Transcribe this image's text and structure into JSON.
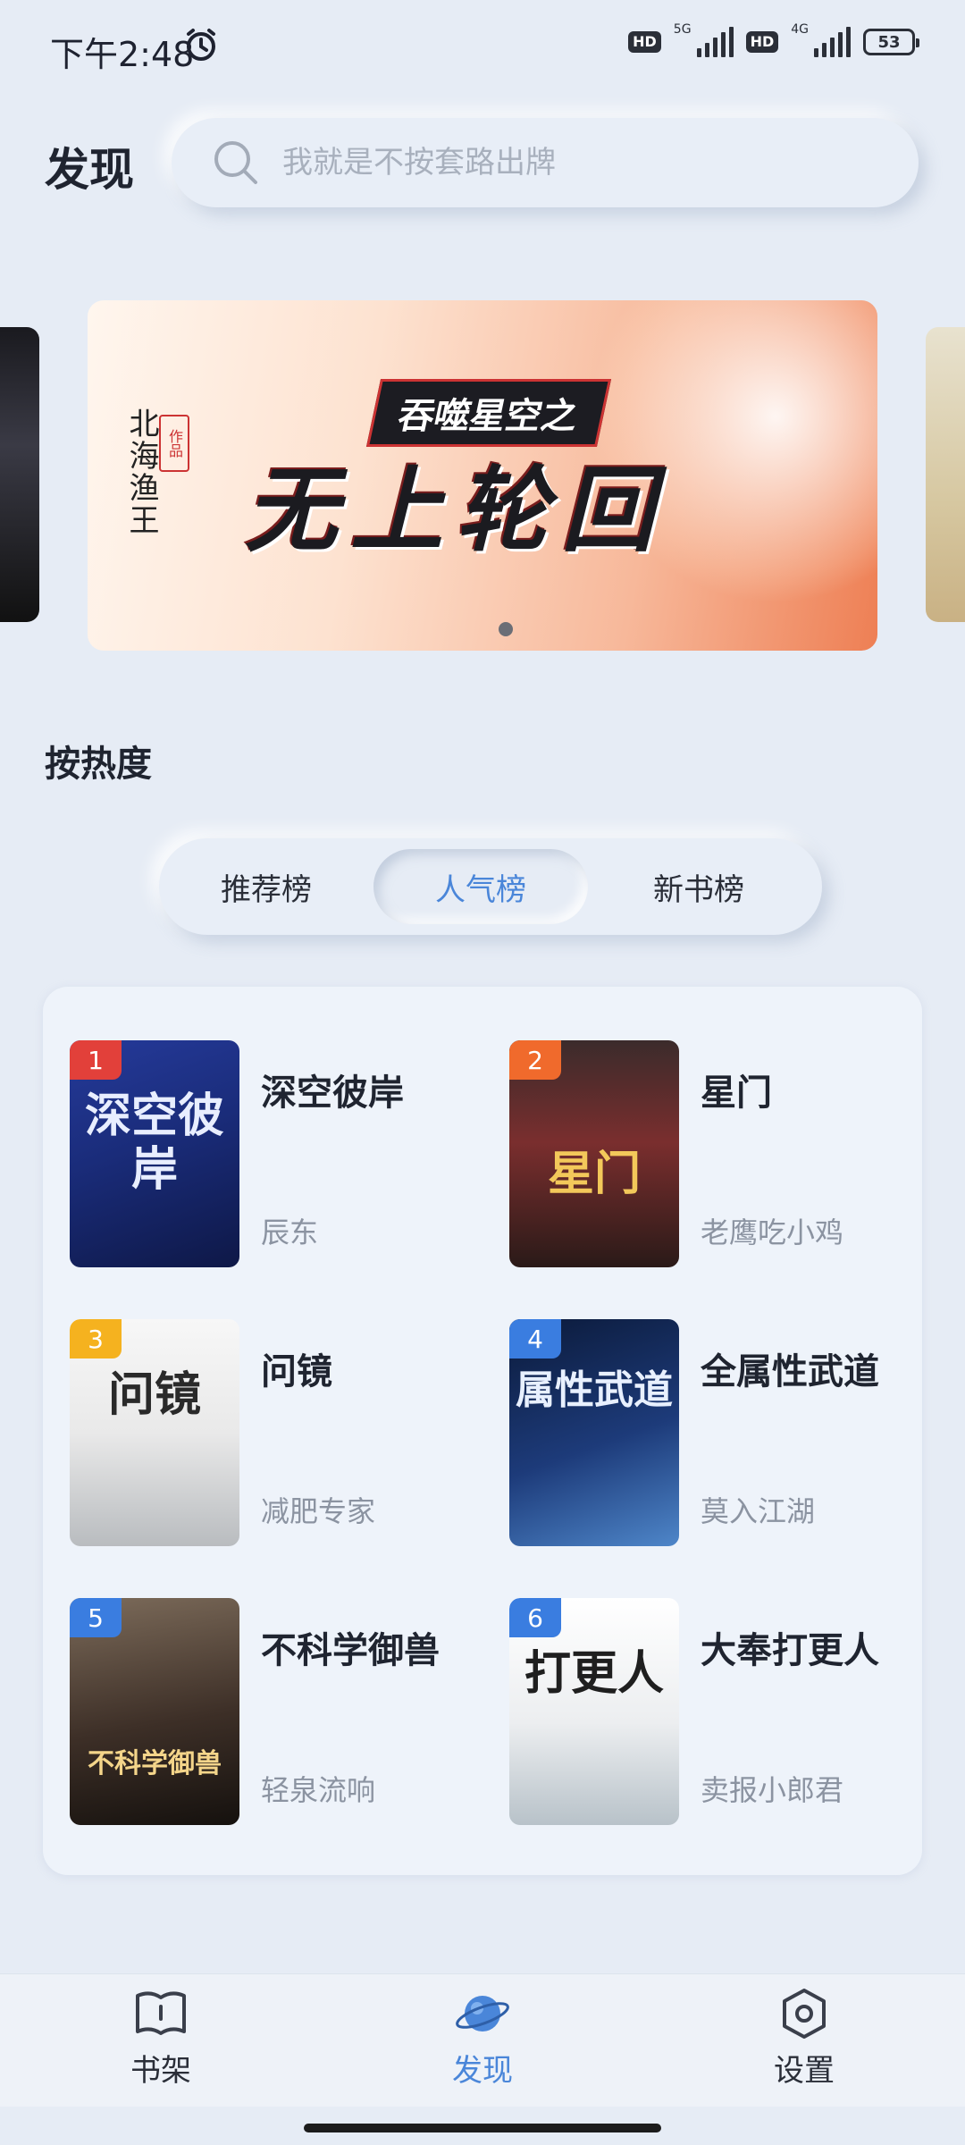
{
  "status_bar": {
    "time": "下午2:48",
    "hd1": "HD",
    "net1": "5G",
    "hd2": "HD",
    "net2": "4G",
    "battery": "53",
    "icons": [
      "alarm-icon",
      "signal-icon",
      "battery-icon"
    ]
  },
  "header": {
    "title": "发现",
    "search_placeholder": "我就是不按套路出牌"
  },
  "banner": {
    "author": "北海渔王",
    "seal": "作品",
    "subtitle": "吞噬星空之",
    "title": "无上轮回",
    "page_index": 1,
    "page_count": 1
  },
  "ranking": {
    "section_title": "按热度",
    "tabs": [
      "推荐榜",
      "人气榜",
      "新书榜"
    ],
    "selected_tab": "人气榜",
    "books": [
      {
        "rank": "1",
        "title": "深空彼岸",
        "author": "辰东",
        "cover_text": "深空彼岸",
        "badge_color": "#e2403a"
      },
      {
        "rank": "2",
        "title": "星门",
        "author": "老鹰吃小鸡",
        "cover_text": "星门",
        "badge_color": "#f06a2c"
      },
      {
        "rank": "3",
        "title": "问镜",
        "author": "减肥专家",
        "cover_text": "问镜",
        "badge_color": "#f5b21f"
      },
      {
        "rank": "4",
        "title": "全属性武道",
        "author": "莫入江湖",
        "cover_text": "属性武道",
        "badge_color": "#3a7de0"
      },
      {
        "rank": "5",
        "title": "不科学御兽",
        "author": "轻泉流响",
        "cover_text": "不科学御兽",
        "badge_color": "#3a7de0"
      },
      {
        "rank": "6",
        "title": "大奉打更人",
        "author": "卖报小郎君",
        "cover_text": "打更人",
        "badge_color": "#3a7de0"
      }
    ]
  },
  "bottom_nav": {
    "items": [
      {
        "label": "书架",
        "icon": "book-icon"
      },
      {
        "label": "发现",
        "icon": "planet-icon"
      },
      {
        "label": "设置",
        "icon": "settings-hex-icon"
      }
    ],
    "active": "发现"
  },
  "colors": {
    "accent": "#4a86d9",
    "background": "#e6ecf5"
  }
}
